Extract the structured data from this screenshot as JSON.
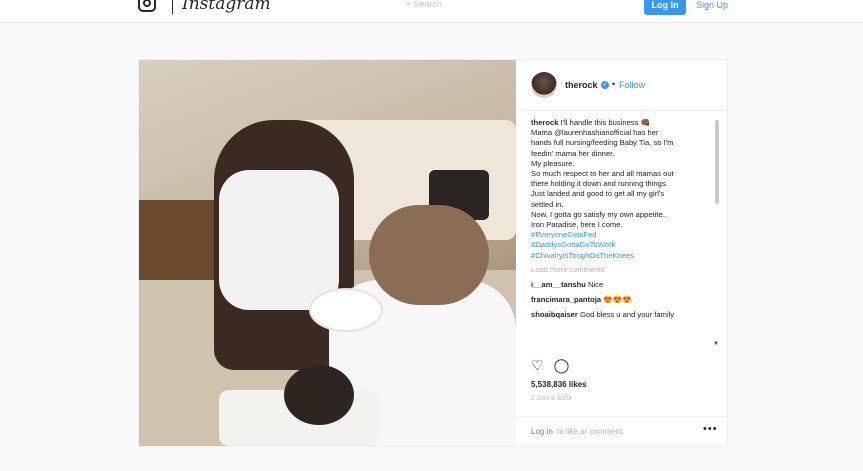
{
  "topbar": {
    "wordmark": "Instagram",
    "search_placeholder": "Search",
    "login_label": "Log In",
    "signup_label": "Sign Up"
  },
  "post": {
    "username": "therock",
    "separator": "•",
    "follow_label": "Follow",
    "caption": {
      "author": "therock",
      "lines": [
        " I'll handle this business 👊🏾",
        "Mama @laurenhashianofficial has her",
        "hands full nursing/feeding Baby Tia, so I'm",
        "feedin' mama her dinner.",
        "My pleasure.",
        "So much respect to her and all mamas out",
        "there holding it down and running things.",
        "Just landed and good to get all my girl's",
        "settled in.",
        "Now, I gotta go satisfy my own appetite..",
        "Iron Paradise, here I come."
      ],
      "hashtags": [
        "#EveryoneGetsFed",
        "#DaddysGottaGoToWork",
        "#ChivalryIsToughOnTheKnees"
      ]
    },
    "load_more": "Load more comments",
    "comments": [
      {
        "user": "i__am__tanshu",
        "text": "Nice"
      },
      {
        "user": "francimara_pantoja",
        "text": "😍😍😍"
      },
      {
        "user": "shoaibqaiser",
        "text": "God bless u and your family"
      }
    ],
    "likes": "5,538,836 likes",
    "time": "2 DAYS AGO",
    "login_prompt": "Log in",
    "like_comment_text": "to like or comment.",
    "more_glyph": "•••"
  },
  "icons": {
    "heart": "♡",
    "comment": "◯",
    "search": "⌕",
    "verified": "✓",
    "scroll_down": "▼"
  },
  "colors": {
    "accent": "#3897f0",
    "text": "#262626",
    "muted": "#b5b5b5"
  }
}
